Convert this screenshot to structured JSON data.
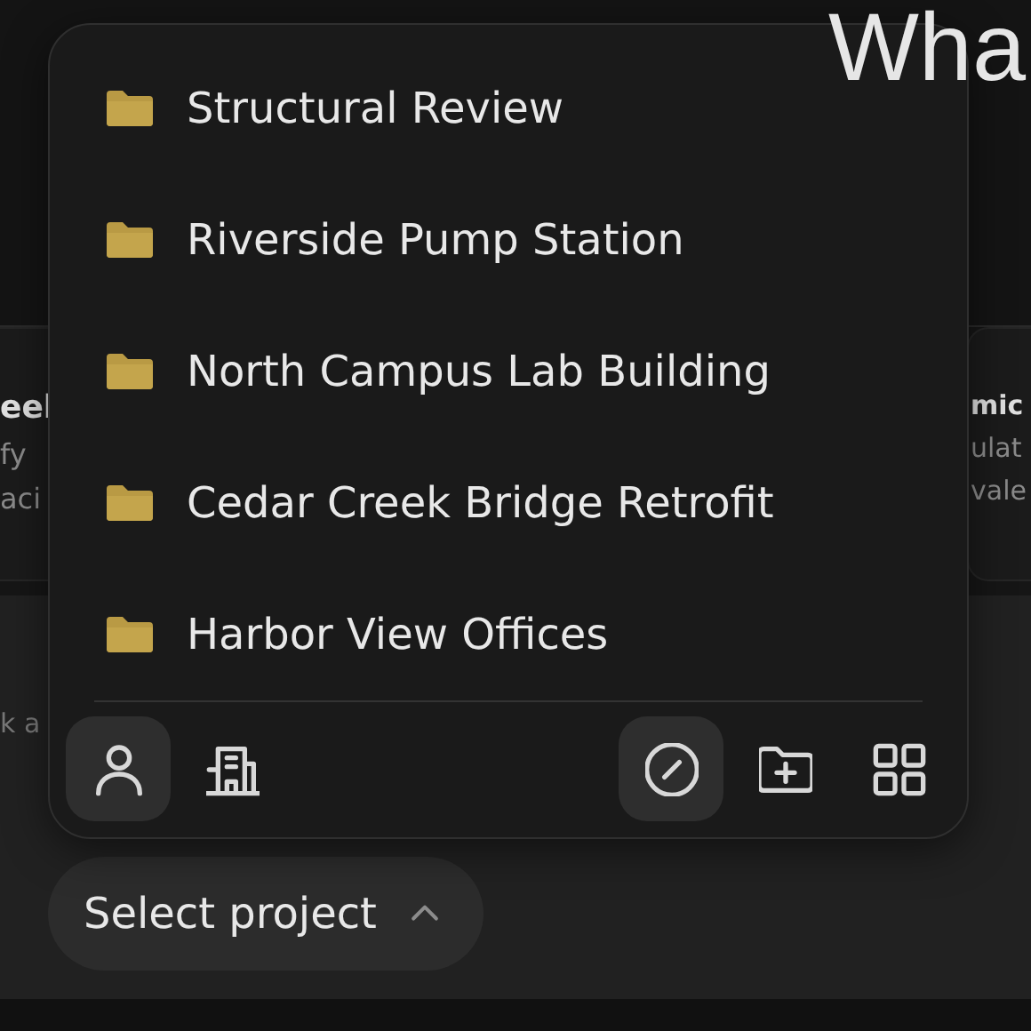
{
  "heading": "Wha",
  "cards": [
    {
      "title": "eel",
      "lines": [
        "fy",
        "aci"
      ]
    },
    {
      "title": "mic",
      "lines": [
        "ulat",
        "vale"
      ]
    }
  ],
  "composer": {
    "placeholder": "k a"
  },
  "project_menu": {
    "items": [
      {
        "label": "Structural Review"
      },
      {
        "label": "Riverside Pump Station"
      },
      {
        "label": "North Campus Lab Building"
      },
      {
        "label": "Cedar Creek Bridge Retrofit"
      },
      {
        "label": "Harbor View Offices"
      }
    ],
    "scope_tabs": [
      {
        "kind": "person",
        "selected": true
      },
      {
        "kind": "building",
        "selected": false
      }
    ],
    "actions": [
      {
        "kind": "none",
        "selected": true
      },
      {
        "kind": "new-folder",
        "selected": false
      },
      {
        "kind": "grid",
        "selected": false
      }
    ]
  },
  "project_button": {
    "label": "Select project",
    "expanded": true
  }
}
